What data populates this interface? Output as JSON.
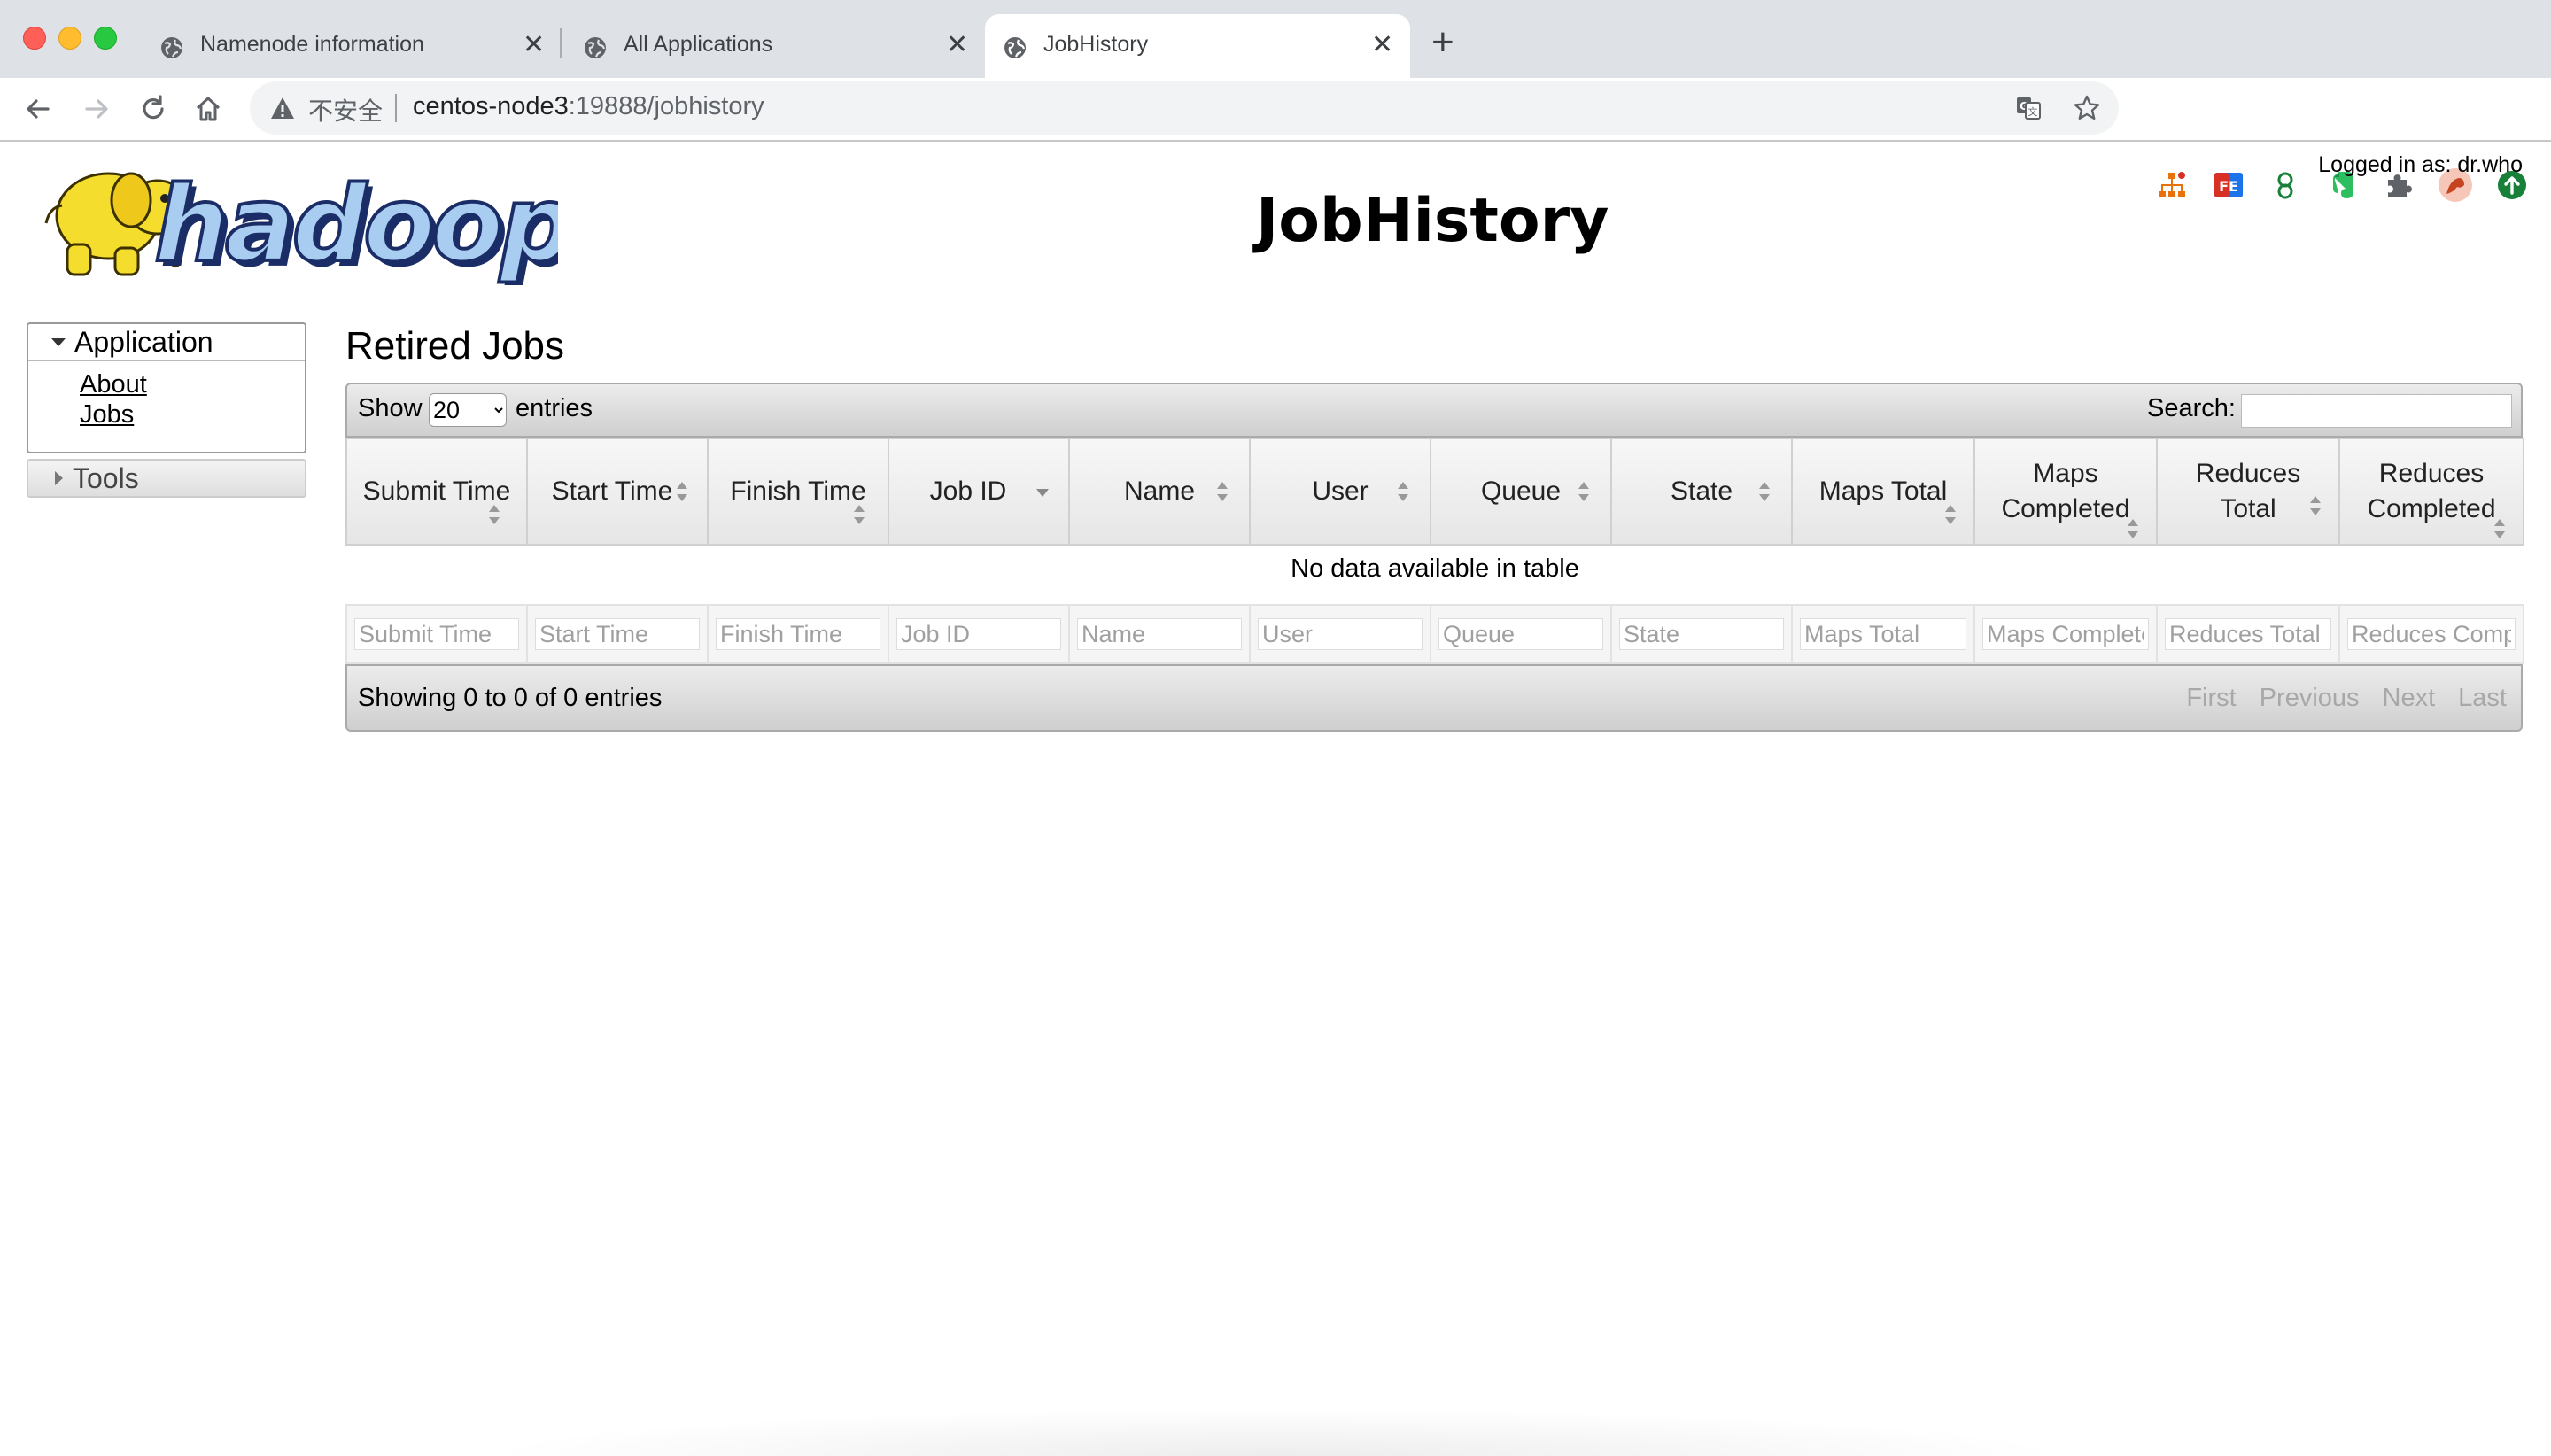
{
  "browser": {
    "tabs": [
      {
        "title": "Namenode information"
      },
      {
        "title": "All Applications"
      },
      {
        "title": "JobHistory"
      }
    ],
    "address": {
      "security_label": "不安全",
      "host": "centos-node3",
      "path": ":19888/jobhistory"
    },
    "extension_icons": [
      "sitemap-icon",
      "fe-icon",
      "extension-icon",
      "evernote-icon",
      "puzzle-icon",
      "avatar",
      "update-icon"
    ]
  },
  "header": {
    "logo_text": "hadoop",
    "title": "JobHistory",
    "logged_in": "Logged in as: dr.who"
  },
  "nav": {
    "application_label": "Application",
    "about_label": "About",
    "jobs_label": "Jobs",
    "tools_label": "Tools"
  },
  "main": {
    "section_title": "Retired Jobs",
    "show_label": "Show",
    "entries_value": "20",
    "entries_label": "entries",
    "search_label": "Search:",
    "columns": [
      {
        "line1": "Submit Time",
        "line2": ""
      },
      {
        "line1": "Start Time",
        "line2": ""
      },
      {
        "line1": "Finish Time",
        "line2": ""
      },
      {
        "line1": "Job ID",
        "line2": ""
      },
      {
        "line1": "Name",
        "line2": ""
      },
      {
        "line1": "User",
        "line2": ""
      },
      {
        "line1": "Queue",
        "line2": ""
      },
      {
        "line1": "State",
        "line2": ""
      },
      {
        "line1": "Maps Total",
        "line2": ""
      },
      {
        "line1": "Maps",
        "line2": "Completed"
      },
      {
        "line1": "Reduces",
        "line2": "Total"
      },
      {
        "line1": "Reduces",
        "line2": "Completed"
      }
    ],
    "no_data": "No data available in table",
    "filters": [
      "Submit Time",
      "Start Time",
      "Finish Time",
      "Job ID",
      "Name",
      "User",
      "Queue",
      "State",
      "Maps Total",
      "Maps Completed",
      "Reduces Total",
      "Reduces Completed"
    ],
    "info": "Showing 0 to 0 of 0 entries",
    "pager": {
      "first": "First",
      "previous": "Previous",
      "next": "Next",
      "last": "Last"
    }
  }
}
